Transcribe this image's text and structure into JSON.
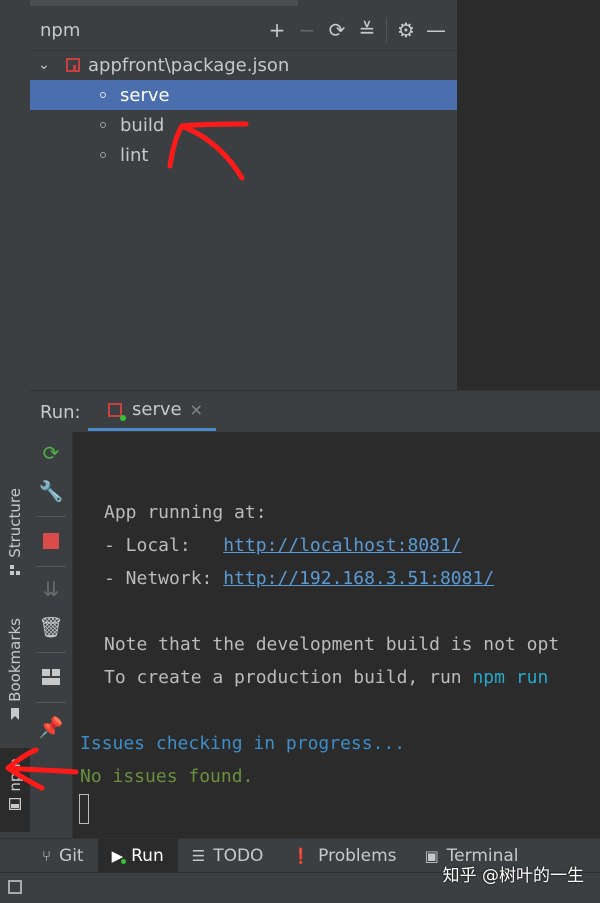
{
  "npm_panel": {
    "title": "npm",
    "tools": {
      "add": "+",
      "remove": "−",
      "refresh": "⟳",
      "collapse": "≚",
      "settings": "⚙",
      "hide": "—"
    },
    "tree": {
      "root_label": "appfront\\package.json",
      "scripts": [
        "serve",
        "build",
        "lint"
      ],
      "selected": "serve"
    }
  },
  "side_tabs": {
    "structure": "Structure",
    "bookmarks": "Bookmarks",
    "npm": "npm"
  },
  "run_panel": {
    "label": "Run:",
    "tab_label": "serve",
    "tab_close": "×"
  },
  "console": {
    "line1": "App running at:",
    "line2_prefix": "- Local:   ",
    "line2_link": "http://localhost:8081/",
    "line3_prefix": "- Network: ",
    "line3_link": "http://192.168.3.51:8081/",
    "line4": "Note that the development build is not opt",
    "line5_prefix": "To create a production build, run ",
    "line5_cmd": "npm run",
    "line6": "Issues checking in progress...",
    "line7": "No issues found."
  },
  "bottom_tabs": [
    {
      "label": "Git",
      "icon": "git-branch-icon",
      "glyph": "⑂"
    },
    {
      "label": "Run",
      "icon": "run-icon",
      "glyph": "▶"
    },
    {
      "label": "TODO",
      "icon": "todo-list-icon",
      "glyph": "☰"
    },
    {
      "label": "Problems",
      "icon": "problems-icon",
      "glyph": "❗"
    },
    {
      "label": "Terminal",
      "icon": "terminal-icon",
      "glyph": "▣"
    }
  ],
  "watermark": "知乎 @树叶的一生",
  "colors": {
    "selection": "#4b6eaf",
    "link": "#5a9bd5",
    "success": "#6a8f3e",
    "info": "#3d8dc7",
    "annotation": "#ff1a1a"
  }
}
